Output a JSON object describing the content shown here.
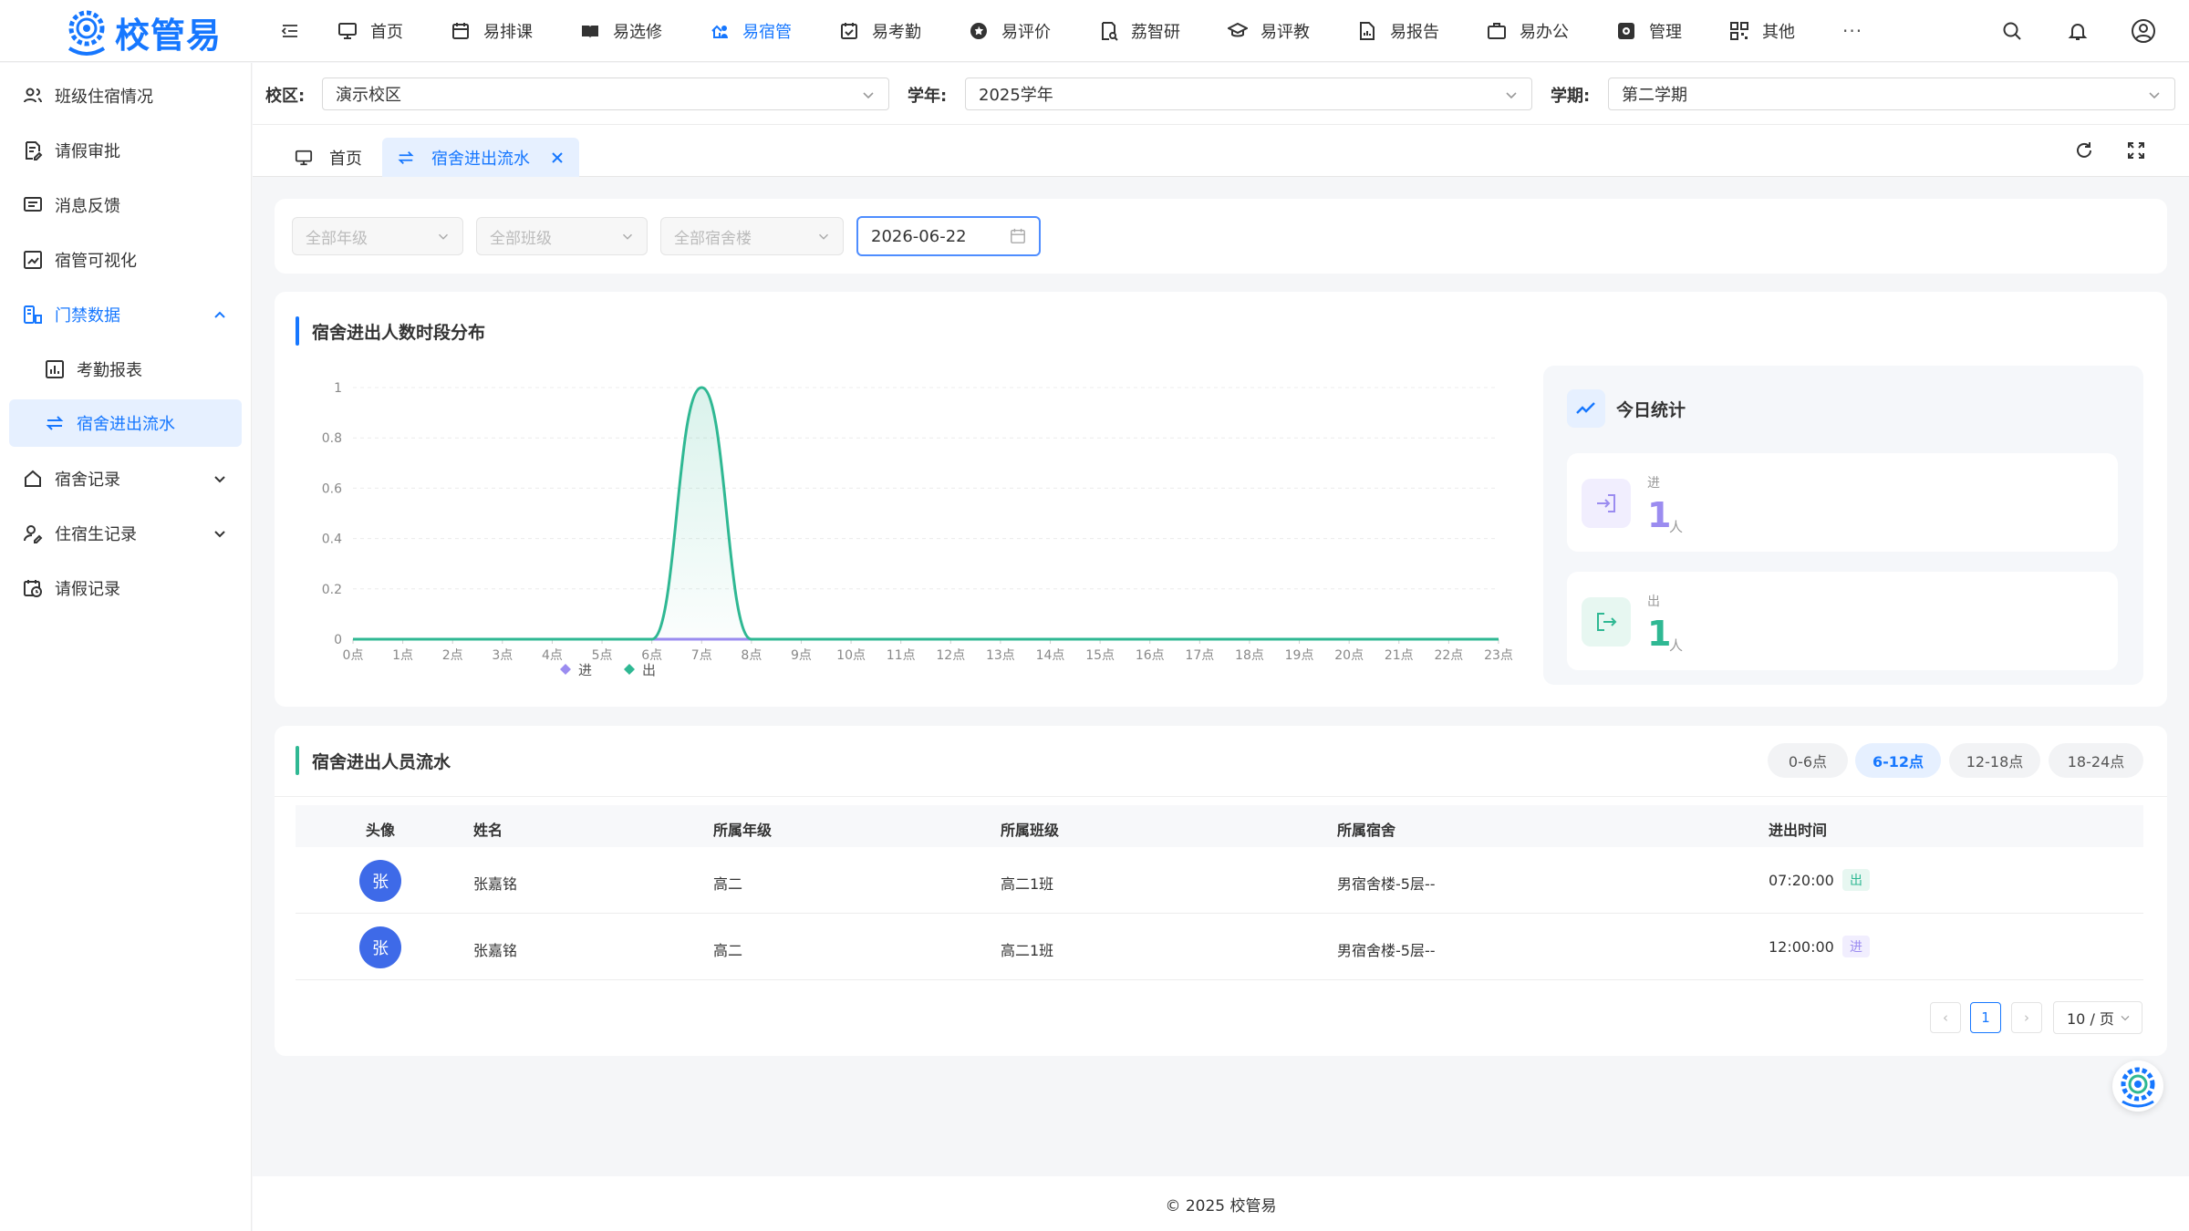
{
  "app": {
    "logo_text": "校管易"
  },
  "nav": {
    "items": [
      {
        "label": "首页",
        "icon": "monitor-icon"
      },
      {
        "label": "易排课",
        "icon": "calendar-icon"
      },
      {
        "label": "易选修",
        "icon": "book-icon"
      },
      {
        "label": "易宿管",
        "icon": "dorm-icon"
      },
      {
        "label": "易考勤",
        "icon": "calendar-check-icon"
      },
      {
        "label": "易评价",
        "icon": "star-badge-icon"
      },
      {
        "label": "荔智研",
        "icon": "research-icon"
      },
      {
        "label": "易评教",
        "icon": "graduation-cap-icon"
      },
      {
        "label": "易报告",
        "icon": "report-icon"
      },
      {
        "label": "易办公",
        "icon": "briefcase-icon"
      },
      {
        "label": "管理",
        "icon": "settings-icon"
      },
      {
        "label": "其他",
        "icon": "apps-icon"
      }
    ],
    "active_index": 3,
    "more": "···"
  },
  "sidebar": {
    "items": [
      {
        "label": "班级住宿情况"
      },
      {
        "label": "请假审批"
      },
      {
        "label": "消息反馈"
      },
      {
        "label": "宿管可视化"
      },
      {
        "label": "门禁数据"
      },
      {
        "label": "考勤报表"
      },
      {
        "label": "宿舍进出流水"
      },
      {
        "label": "宿舍记录"
      },
      {
        "label": "住宿生记录"
      },
      {
        "label": "请假记录"
      }
    ]
  },
  "filters": {
    "campus_label": "校区:",
    "campus_value": "演示校区",
    "year_label": "学年:",
    "year_value": "2025学年",
    "term_label": "学期:",
    "term_value": "第二学期"
  },
  "tabs": [
    {
      "label": "首页"
    },
    {
      "label": "宿舍进出流水"
    }
  ],
  "query": {
    "grade_placeholder": "全部年级",
    "class_placeholder": "全部班级",
    "building_placeholder": "全部宿舍楼",
    "date_value": "2026-06-22"
  },
  "chart_section": {
    "title": "宿舍进出人数时段分布"
  },
  "chart_data": {
    "type": "line",
    "title": "",
    "xlabel": "",
    "ylabel": "",
    "categories": [
      "0点",
      "1点",
      "2点",
      "3点",
      "4点",
      "5点",
      "6点",
      "7点",
      "8点",
      "9点",
      "10点",
      "11点",
      "12点",
      "13点",
      "14点",
      "15点",
      "16点",
      "17点",
      "18点",
      "19点",
      "20点",
      "21点",
      "22点",
      "23点"
    ],
    "y_ticks": [
      "0",
      "0.2",
      "0.4",
      "0.6",
      "0.8",
      "1"
    ],
    "ylim": [
      0,
      1
    ],
    "series": [
      {
        "name": "进",
        "color": "#9b8cf0",
        "values": [
          0,
          0,
          0,
          0,
          0,
          0,
          0,
          0,
          0,
          0,
          0,
          0,
          0,
          0,
          0,
          0,
          0,
          0,
          0,
          0,
          0,
          0,
          0,
          0
        ]
      },
      {
        "name": "出",
        "color": "#2fb893",
        "values": [
          0,
          0,
          0,
          0,
          0,
          0,
          0,
          1,
          0,
          0,
          0,
          0,
          0,
          0,
          0,
          0,
          0,
          0,
          0,
          0,
          0,
          0,
          0,
          0
        ]
      }
    ],
    "smooth": true,
    "legend_position": "bottom"
  },
  "stats": {
    "title": "今日统计",
    "in_label": "进",
    "in_value": "1",
    "out_label": "出",
    "out_value": "1",
    "unit": "人"
  },
  "flow": {
    "title": "宿舍进出人员流水",
    "segments": [
      "0-6点",
      "6-12点",
      "12-18点",
      "18-24点"
    ],
    "active_segment": 1,
    "columns": [
      "头像",
      "姓名",
      "所属年级",
      "所属班级",
      "所属宿舍",
      "进出时间"
    ],
    "rows": [
      {
        "avatar": "张",
        "name": "张嘉铭",
        "grade": "高二",
        "class": "高二1班",
        "dorm": "男宿舍楼-5层--",
        "time": "07:20:00",
        "direction": "出"
      },
      {
        "avatar": "张",
        "name": "张嘉铭",
        "grade": "高二",
        "class": "高二1班",
        "dorm": "男宿舍楼-5层--",
        "time": "12:00:00",
        "direction": "进"
      }
    ]
  },
  "pagination": {
    "prev": "‹",
    "current": "1",
    "next": "›",
    "page_size": "10 / 页"
  },
  "footer": {
    "text": "© 2025 校管易"
  },
  "colors": {
    "primary": "#1677ff",
    "in": "#9b8cf0",
    "out": "#2fb893",
    "avatar": "#3e6ae8"
  }
}
